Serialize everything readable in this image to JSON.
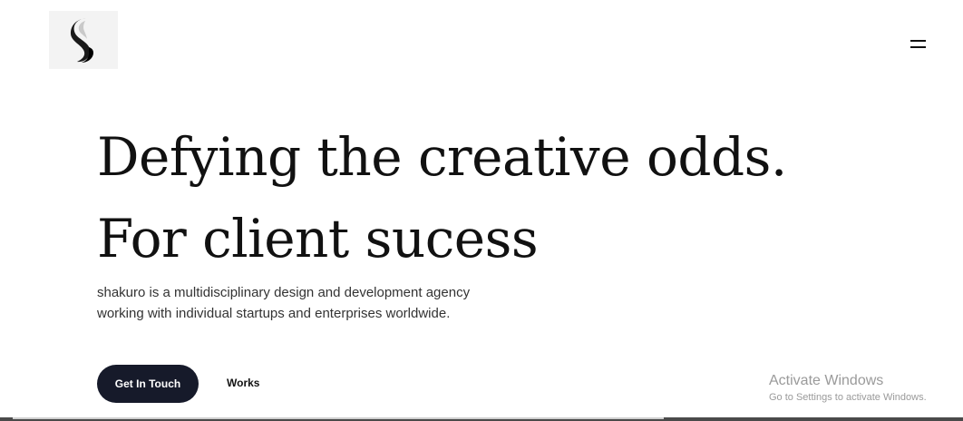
{
  "header": {
    "logo_icon": "brand-logo-icon",
    "menu_icon": "hamburger-menu-icon"
  },
  "hero": {
    "title_line1": "Defying the creative odds.",
    "title_line2": "For client sucess",
    "description_line1": "shakuro is a multidisciplinary design and development agency",
    "description_line2": "working with individual startups and enterprises worldwide."
  },
  "actions": {
    "primary_label": "Get In Touch",
    "secondary_label": "Works"
  },
  "os_overlay": {
    "title": "Activate Windows",
    "subtitle": "Go to Settings to activate Windows."
  },
  "colors": {
    "background": "#ffffff",
    "text": "#111111",
    "button_bg": "#161a2a",
    "button_text": "#ffffff",
    "watermark": "#9a9a9a"
  }
}
